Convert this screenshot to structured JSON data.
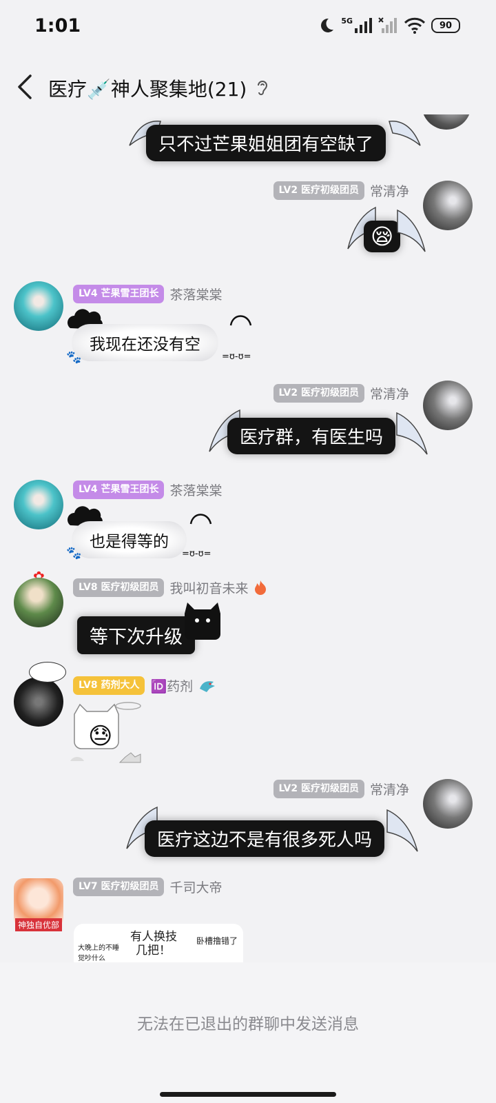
{
  "status": {
    "time": "1:01",
    "network": "5G",
    "battery": "90"
  },
  "header": {
    "title": "医疗💉神人聚集地(21)"
  },
  "messages": [
    {
      "text": "只不过芒果姐姐团有空缺了"
    },
    {
      "badge": "LV2 医疗初级团员",
      "name": "常清净",
      "emoji": "😪"
    },
    {
      "badge": "LV4 芒果雪王团长",
      "name": "茶落棠棠",
      "text": "我现在还没有空",
      "face": "=ʊ-ʊ="
    },
    {
      "badge": "LV2 医疗初级团员",
      "name": "常清净",
      "text": "医疗群，有医生吗"
    },
    {
      "badge": "LV4 芒果雪王团长",
      "name": "茶落棠棠",
      "text": "也是得等的",
      "face": "=ʊ-ʊ="
    },
    {
      "badge": "LV8 医疗初级团员",
      "name": "我叫初音未来",
      "text": "等下次升级"
    },
    {
      "badge": "LV8 药剂大人",
      "name": "🆔药剂",
      "emoji": "😓"
    },
    {
      "badge": "LV2 医疗初级团员",
      "name": "常清净",
      "text": "医疗这边不是有很多死人吗"
    },
    {
      "badge": "LV7 医疗初级团员",
      "name": "千司大帝",
      "avatar_tag": "神独自优部",
      "comic": {
        "t1": "大晚上的不睡觉吵什么",
        "t2": "有人换技",
        "t3": "几把！",
        "t4": "卧槽撸错了"
      }
    }
  ],
  "footer": {
    "notice": "无法在已退出的群聊中发送消息"
  },
  "colors": {
    "dark_bubble": "#141414",
    "badge_gray": "#b3b3b8",
    "badge_purple": "#c48be8",
    "badge_gold": "#f5c23a"
  }
}
